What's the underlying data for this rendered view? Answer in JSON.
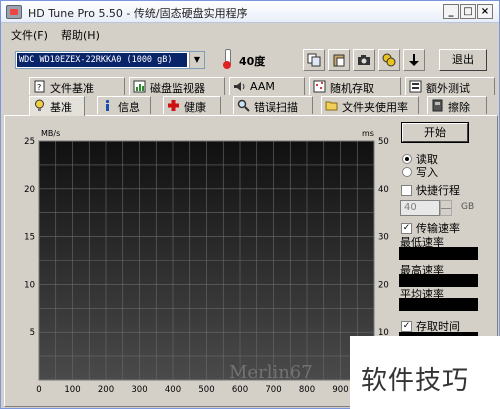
{
  "window": {
    "title": "HD Tune Pro 5.50 - 传统/固态硬盘实用程序",
    "controls": {
      "minimize": "_",
      "maximize": "□",
      "close": "×"
    }
  },
  "menu": [
    {
      "label": "文件(F)"
    },
    {
      "label": "帮助(H)"
    }
  ],
  "toolbar": {
    "drive": "WDC WD10EZEX-22RKKA0 (1000 gB)",
    "temperature": "40度",
    "exit_label": "退出",
    "buttons": [
      "copy-icon",
      "paste-icon",
      "camera-icon",
      "disks-icon",
      "download-icon"
    ]
  },
  "tabs": {
    "row1": [
      {
        "label": "文件基准",
        "icon": "file-benchmark-icon"
      },
      {
        "label": "磁盘监视器",
        "icon": "disk-monitor-icon"
      },
      {
        "label": "AAM",
        "icon": "speaker-icon"
      },
      {
        "label": "随机存取",
        "icon": "random-access-icon"
      },
      {
        "label": "额外测试",
        "icon": "extra-tests-icon"
      }
    ],
    "row2": [
      {
        "label": "基准",
        "icon": "benchmark-icon",
        "active": true
      },
      {
        "label": "信息",
        "icon": "info-icon"
      },
      {
        "label": "健康",
        "icon": "health-icon"
      },
      {
        "label": "错误扫描",
        "icon": "magnifier-icon"
      },
      {
        "label": "文件夹使用率",
        "icon": "folder-icon"
      },
      {
        "label": "擦除",
        "icon": "erase-icon"
      }
    ]
  },
  "chart_data": {
    "type": "line",
    "title": "",
    "ylabel_left": "MB/s",
    "ylabel_right": "ms",
    "x_ticks": [
      "0",
      "100",
      "200",
      "300",
      "400",
      "500",
      "600",
      "700",
      "800",
      "900"
    ],
    "y_left_ticks": [
      "25",
      "20",
      "15",
      "10",
      "5"
    ],
    "y_right_ticks": [
      "50",
      "40",
      "30",
      "20",
      "10"
    ],
    "ylim_left": [
      0,
      25
    ],
    "ylim_right": [
      0,
      50
    ],
    "xlim": [
      0,
      1000
    ],
    "grid": true,
    "series": []
  },
  "side_panel": {
    "start_label": "开始",
    "read_label": "读取",
    "write_label": "写入",
    "mode": "read",
    "quick_stroke_label": "快捷行程",
    "quick_stroke_checked": false,
    "quick_stroke_value": "40",
    "quick_stroke_unit": "GB",
    "transfer_rate_label": "传输速率",
    "transfer_rate_checked": true,
    "min_rate_label": "最低速率",
    "max_rate_label": "最高速率",
    "avg_rate_label": "平均速率",
    "access_time_label": "存取时间",
    "access_time_checked": true
  },
  "watermark": {
    "site_text": "软件技巧",
    "author": "Merlin67"
  }
}
